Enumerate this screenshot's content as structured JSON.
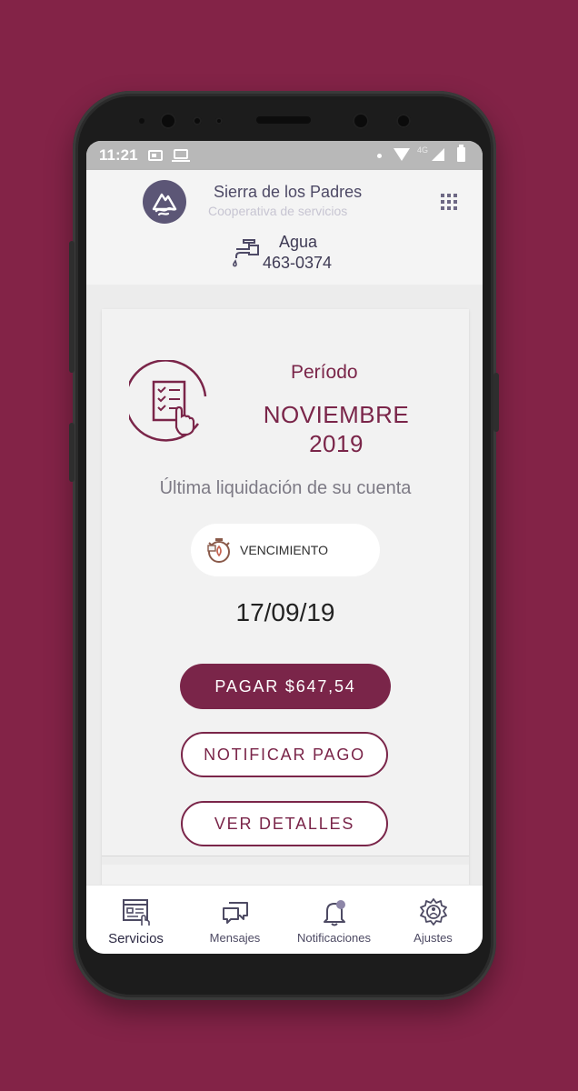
{
  "status_bar": {
    "time": "11:21",
    "network": "4G"
  },
  "header": {
    "org_name": "Sierra de los Padres",
    "org_subtitle": "Cooperativa de servicios",
    "service_name": "Agua",
    "service_number": "463-0374",
    "icons": [
      "logo-mountain-icon",
      "apps-grid-icon",
      "faucet-icon"
    ]
  },
  "bill": {
    "period_label": "Período",
    "period_month": "NOVIEMBRE",
    "period_year": "2019",
    "description": "Última liquidación de su cuenta",
    "due_label": "VENCIMIENTO",
    "due_date": "17/09/19",
    "pay_button": "PAGAR $647,54",
    "notify_button": "NOTIFICAR PAGO",
    "details_button": "VER DETALLES"
  },
  "bottom_nav": {
    "items": [
      {
        "label": "Servicios",
        "icon": "services-icon",
        "active": true
      },
      {
        "label": "Mensajes",
        "icon": "messages-icon",
        "active": false
      },
      {
        "label": "Notificaciones",
        "icon": "bell-icon",
        "active": false
      },
      {
        "label": "Ajustes",
        "icon": "settings-gear-icon",
        "active": false
      }
    ]
  },
  "colors": {
    "background": "#832347",
    "brand": "#7a2549",
    "header_text": "#4e4a66",
    "logo_bg": "#5c5676"
  }
}
